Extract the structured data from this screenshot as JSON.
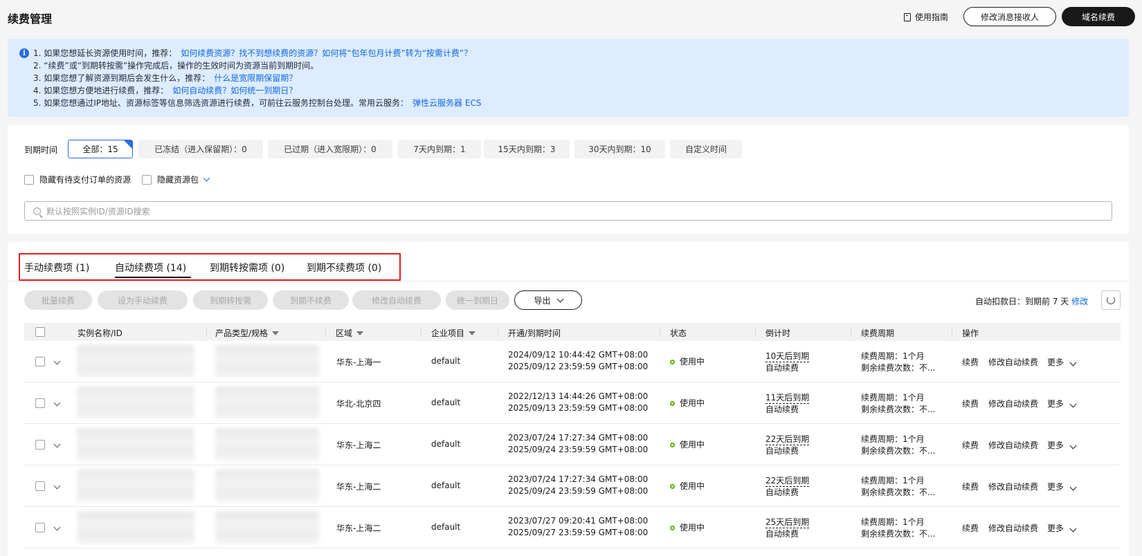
{
  "header": {
    "title": "续费管理",
    "guide_label": "使用指南",
    "modify_receiver_label": "修改消息接收人",
    "domain_renew_label": "域名续费"
  },
  "notice": {
    "icon": "info-icon",
    "lines": [
      {
        "text": "1. 如果您想延长资源使用时间，推荐：",
        "link": "如何续费资源？找不到想续费的资源？如何将“包年包月计费”转为“按需计费”？"
      },
      {
        "text": "2. “续费”或“到期转按需”操作完成后，操作的生效时间为资源当前到期时间。",
        "link": ""
      },
      {
        "text": "3. 如果您想了解资源到期后会发生什么，推荐：",
        "link": "什么是宽限期保留期？"
      },
      {
        "text": "4. 如果您想方便地进行续费，推荐：",
        "link": "如何自动续费？如何统一到期日？"
      },
      {
        "text": "5. 如果您想通过IP地址、资源标签等信息筛选资源进行续费，可前往云服务控制台处理。常用云服务：",
        "link": "弹性云服务器 ECS"
      }
    ]
  },
  "filters": {
    "expire_label": "到期时间",
    "chips": [
      "全部：15",
      "已冻结（进入保留期）：0",
      "已过期（进入宽限期）：0",
      "7天内到期：1",
      "15天内到期：3",
      "30天内到期：10",
      "自定义时间"
    ],
    "hide_pending_label": "隐藏有待支付订单的资源",
    "hide_package_label": "隐藏资源包",
    "search_placeholder": "默认按照实例ID/资源ID搜索"
  },
  "tabs": [
    "手动续费项 (1)",
    "自动续费项 (14)",
    "到期转按需项 (0)",
    "到期不续费项 (0)"
  ],
  "toolbar": {
    "buttons": [
      "批量续费",
      "设为手动续费",
      "到期转按需",
      "到期不续费",
      "修改自动续费",
      "统一到期日"
    ],
    "export_label": "导出",
    "auto_deduct_text": "自动扣款日：到期前 7 天",
    "modify_label": "修改"
  },
  "table": {
    "headers": [
      "实例名称/ID",
      "产品类型/规格",
      "区域",
      "企业项目",
      "开通/到期时间",
      "状态",
      "倒计时",
      "续费周期",
      "操作"
    ],
    "rows": [
      {
        "region": "华东-上海一",
        "project": "default",
        "open": "2024/09/12 10:44:42 GMT+08:00",
        "expire": "2025/09/12 23:59:59 GMT+08:00",
        "status": "使用中",
        "countdown": "10天后到期",
        "renew_type": "自动续费",
        "period": "续费周期：1个月",
        "remaining": "剩余续费次数：不..."
      },
      {
        "region": "华北-北京四",
        "project": "default",
        "open": "2022/12/13 14:44:26 GMT+08:00",
        "expire": "2025/09/13 23:59:59 GMT+08:00",
        "status": "使用中",
        "countdown": "11天后到期",
        "renew_type": "自动续费",
        "period": "续费周期：1个月",
        "remaining": "剩余续费次数：不..."
      },
      {
        "region": "华东-上海二",
        "project": "default",
        "open": "2023/07/24 17:27:34 GMT+08:00",
        "expire": "2025/09/24 23:59:59 GMT+08:00",
        "status": "使用中",
        "countdown": "22天后到期",
        "renew_type": "自动续费",
        "period": "续费周期：1个月",
        "remaining": "剩余续费次数：不..."
      },
      {
        "region": "华东-上海二",
        "project": "default",
        "open": "2023/07/24 17:27:34 GMT+08:00",
        "expire": "2025/09/24 23:59:59 GMT+08:00",
        "status": "使用中",
        "countdown": "22天后到期",
        "renew_type": "自动续费",
        "period": "续费周期：1个月",
        "remaining": "剩余续费次数：不..."
      },
      {
        "region": "华东-上海二",
        "project": "default",
        "open": "2023/07/27 09:20:41 GMT+08:00",
        "expire": "2025/09/27 23:59:59 GMT+08:00",
        "status": "使用中",
        "countdown": "25天后到期",
        "renew_type": "自动续费",
        "period": "续费周期：1个月",
        "remaining": "剩余续费次数：不..."
      }
    ],
    "actions": {
      "renew": "续费",
      "modify_auto": "修改自动续费",
      "more": "更多"
    }
  },
  "colors": {
    "accent": "#0d6ae0",
    "dark": "#191919",
    "notice_bg": "#deecff",
    "status_green": "#5cb300",
    "highlight": "#e02020"
  }
}
